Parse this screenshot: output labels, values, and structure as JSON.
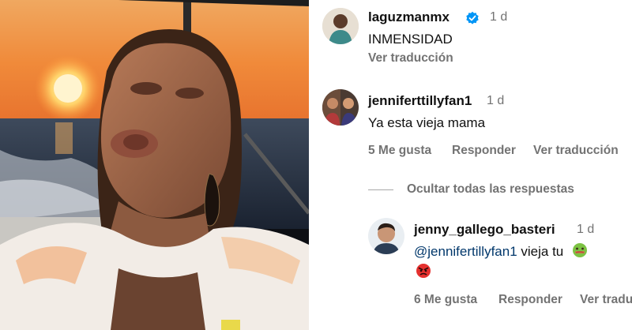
{
  "post": {
    "username": "laguzmanmx",
    "time": "1 d",
    "caption": "INMENSIDAD",
    "translate": "Ver traducción"
  },
  "comments": [
    {
      "username": "jenniferttillyfan1",
      "time": "1 d",
      "text": "Ya esta vieja mama",
      "likes": "5 Me gusta",
      "reply": "Responder",
      "translate": "Ver traducción"
    }
  ],
  "hide_replies": "Ocultar todas las respuestas",
  "replies": [
    {
      "username": "jenny_gallego_basteri",
      "time": "1 d",
      "mention": "@jennifertillyfan1",
      "text": " vieja tu",
      "likes": "6 Me gusta",
      "reply": "Responder",
      "translate": "Ver tradu"
    }
  ],
  "colors": {
    "verified": "#0095f6",
    "mention": "#00376b",
    "muted": "#737373"
  },
  "icons": [
    "verified-badge-icon",
    "nauseated-face-emoji",
    "angry-face-emoji"
  ]
}
